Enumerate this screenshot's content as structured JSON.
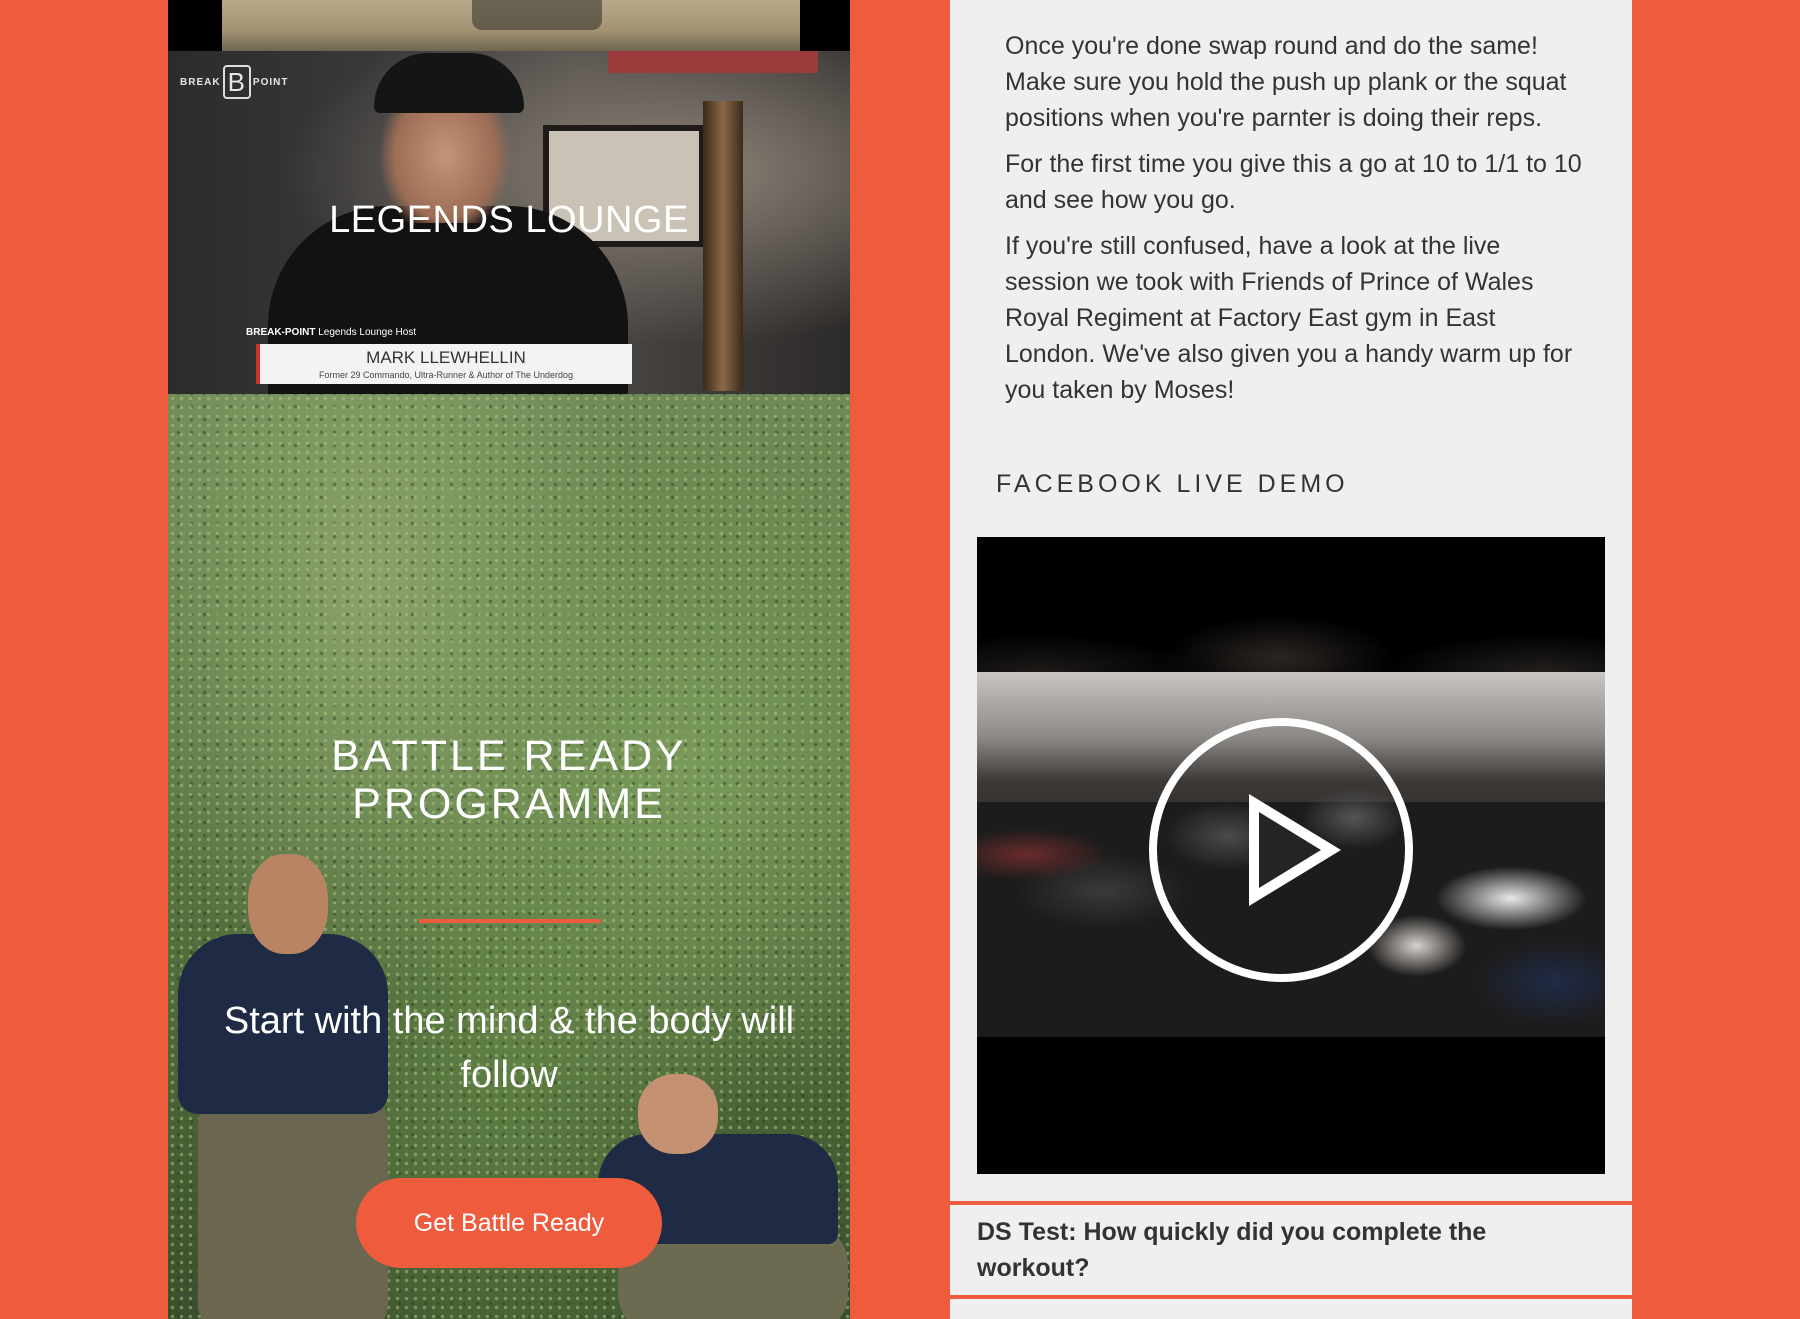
{
  "left": {
    "legends": {
      "logo_left": "BREAK",
      "logo_letter": "B",
      "logo_right": "POINT",
      "title": "LEGENDS LOUNGE",
      "lower_third_brand": "BREAK-POINT",
      "lower_third_role": "Legends Lounge Host",
      "name": "MARK LLEWHELLIN",
      "bio": "Former 29 Commando, Ultra-Runner & Author of The Underdog"
    },
    "battle": {
      "heading_line1": "BATTLE READY",
      "heading_line2": "PROGRAMME",
      "tagline": "Start with the mind & the body will follow",
      "cta_label": "Get Battle Ready"
    }
  },
  "right": {
    "paragraphs": [
      "Once you're done swap round and do the same! Make sure you hold the push up plank or the squat positions when you're parnter is doing their reps.",
      "For the first time you give this a go at 10 to 1/1 to 10 and see how you go.",
      "If you're still confused, have a look at the live session we took with Friends of Prince of Wales Royal Regiment at Factory East gym in East London. We've also given you a handy warm up for you taken by Moses!"
    ],
    "video_section_title": "FACEBOOK LIVE DEMO",
    "video_icon": "play-icon",
    "question": "DS Test: How quickly did you complete the workout?"
  },
  "colors": {
    "accent": "#ef5b3d",
    "panel": "#efefef",
    "text": "#333333"
  }
}
